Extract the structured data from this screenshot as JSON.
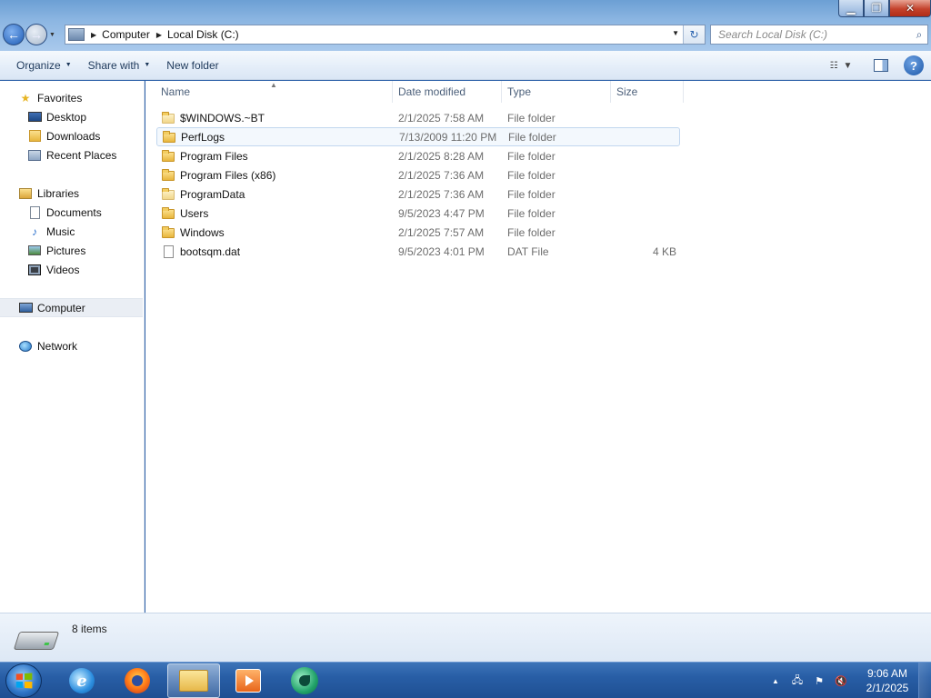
{
  "window": {
    "controls": {
      "minimize": "▁",
      "maximize": "❐",
      "close": "✕"
    }
  },
  "address": {
    "breadcrumbs": [
      "Computer",
      "Local Disk (C:)"
    ]
  },
  "search": {
    "placeholder": "Search Local Disk (C:)"
  },
  "commandbar": {
    "organize_label": "Organize",
    "share_label": "Share with",
    "new_folder_label": "New folder"
  },
  "navpane": {
    "favorites": {
      "label": "Favorites",
      "items": [
        {
          "label": "Desktop",
          "icon": "desktop-icon"
        },
        {
          "label": "Downloads",
          "icon": "downloads-icon"
        },
        {
          "label": "Recent Places",
          "icon": "recent-places-icon"
        }
      ]
    },
    "libraries": {
      "label": "Libraries",
      "items": [
        {
          "label": "Documents",
          "icon": "documents-icon"
        },
        {
          "label": "Music",
          "icon": "music-icon"
        },
        {
          "label": "Pictures",
          "icon": "pictures-icon"
        },
        {
          "label": "Videos",
          "icon": "videos-icon"
        }
      ]
    },
    "computer": {
      "label": "Computer"
    },
    "network": {
      "label": "Network"
    }
  },
  "filelist": {
    "columns": {
      "name": "Name",
      "date": "Date modified",
      "type": "Type",
      "size": "Size"
    },
    "rows": [
      {
        "name": "$WINDOWS.~BT",
        "date": "2/1/2025 7:58 AM",
        "type": "File folder",
        "size": "",
        "icon": "folder-icon"
      },
      {
        "name": "PerfLogs",
        "date": "7/13/2009 11:20 PM",
        "type": "File folder",
        "size": "",
        "icon": "folder-icon"
      },
      {
        "name": "Program Files",
        "date": "2/1/2025 8:28 AM",
        "type": "File folder",
        "size": "",
        "icon": "folder-icon"
      },
      {
        "name": "Program Files (x86)",
        "date": "2/1/2025 7:36 AM",
        "type": "File folder",
        "size": "",
        "icon": "folder-icon"
      },
      {
        "name": "ProgramData",
        "date": "2/1/2025 7:36 AM",
        "type": "File folder",
        "size": "",
        "icon": "folder-icon"
      },
      {
        "name": "Users",
        "date": "9/5/2023 4:47 PM",
        "type": "File folder",
        "size": "",
        "icon": "folder-icon"
      },
      {
        "name": "Windows",
        "date": "2/1/2025 7:57 AM",
        "type": "File folder",
        "size": "",
        "icon": "folder-icon"
      },
      {
        "name": "bootsqm.dat",
        "date": "9/5/2023 4:01 PM",
        "type": "DAT File",
        "size": "4 KB",
        "icon": "file-icon"
      }
    ]
  },
  "details": {
    "item_count": "8 items"
  },
  "taskbar": {
    "clock_time": "9:06 AM",
    "clock_date": "2/1/2025"
  },
  "colors": {
    "accent": "#2a5fa8",
    "folder": "#e8b63d",
    "hover_row_border": "#c2d7ef"
  }
}
